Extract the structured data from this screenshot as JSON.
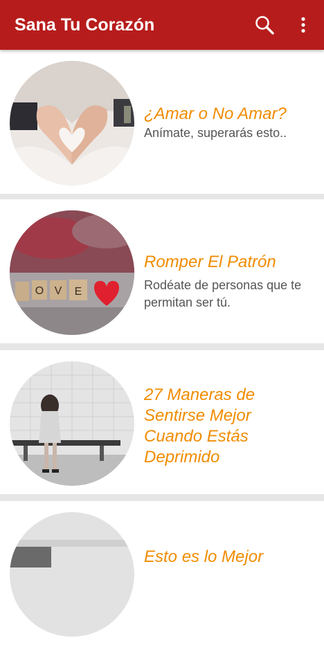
{
  "app": {
    "title": "Sana Tu Corazón",
    "search_icon": "search-icon",
    "more_icon": "more-vert-icon",
    "colors": {
      "appbar": "#b71c1c",
      "title_accent": "#f08c00",
      "subtitle": "#555555",
      "divider": "#e6e6e6"
    }
  },
  "articles": [
    {
      "title": "¿Amar o No Amar?",
      "subtitle": "Anímate, superarás esto..",
      "image": "heart-hands-photo"
    },
    {
      "title": "Romper El Patrón",
      "subtitle": "Rodéate de personas que te permitan ser tú.",
      "image": "love-tiles-photo"
    },
    {
      "title": "27 Maneras de Sentirse Mejor Cuando Estás Deprimido",
      "subtitle": "",
      "image": "sad-woman-bench-photo"
    },
    {
      "title": "Esto es lo Mejor",
      "subtitle": "",
      "image": "grey-photo"
    }
  ]
}
